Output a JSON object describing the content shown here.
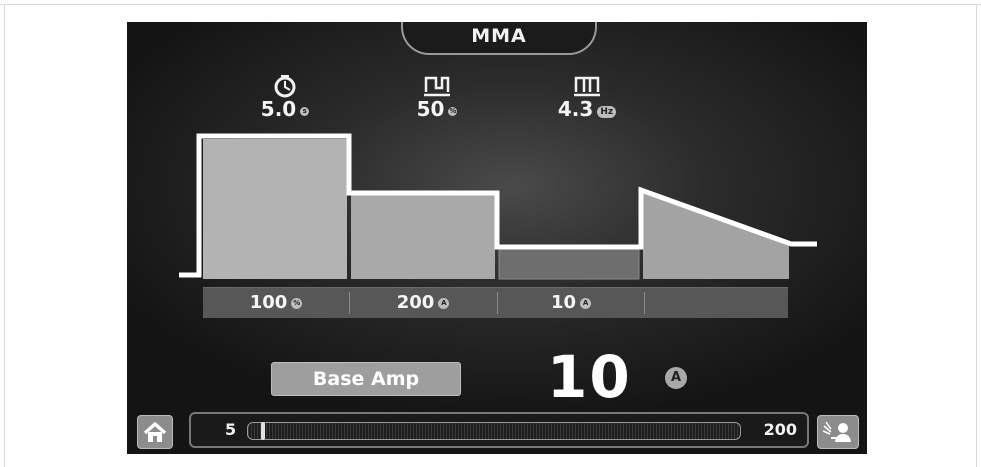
{
  "mode": {
    "title": "MMA"
  },
  "params": [
    {
      "icon": "timer-icon",
      "value": "5.0",
      "unit": "s"
    },
    {
      "icon": "pulse-duty-icon",
      "value": "50",
      "unit": "%"
    },
    {
      "icon": "pulse-frequency-icon",
      "value": "4.3",
      "unit": "Hz"
    }
  ],
  "segments": [
    {
      "value": "100",
      "unit": "%"
    },
    {
      "value": "200",
      "unit": "A"
    },
    {
      "value": "10",
      "unit": "A"
    },
    {
      "value": "",
      "unit": ""
    }
  ],
  "selected": {
    "label": "Base Amp",
    "value": "10",
    "unit": "A"
  },
  "slider": {
    "min": "5",
    "max": "200",
    "current": 10
  },
  "icons": {
    "home": "home-icon",
    "welder": "welder-icon"
  }
}
